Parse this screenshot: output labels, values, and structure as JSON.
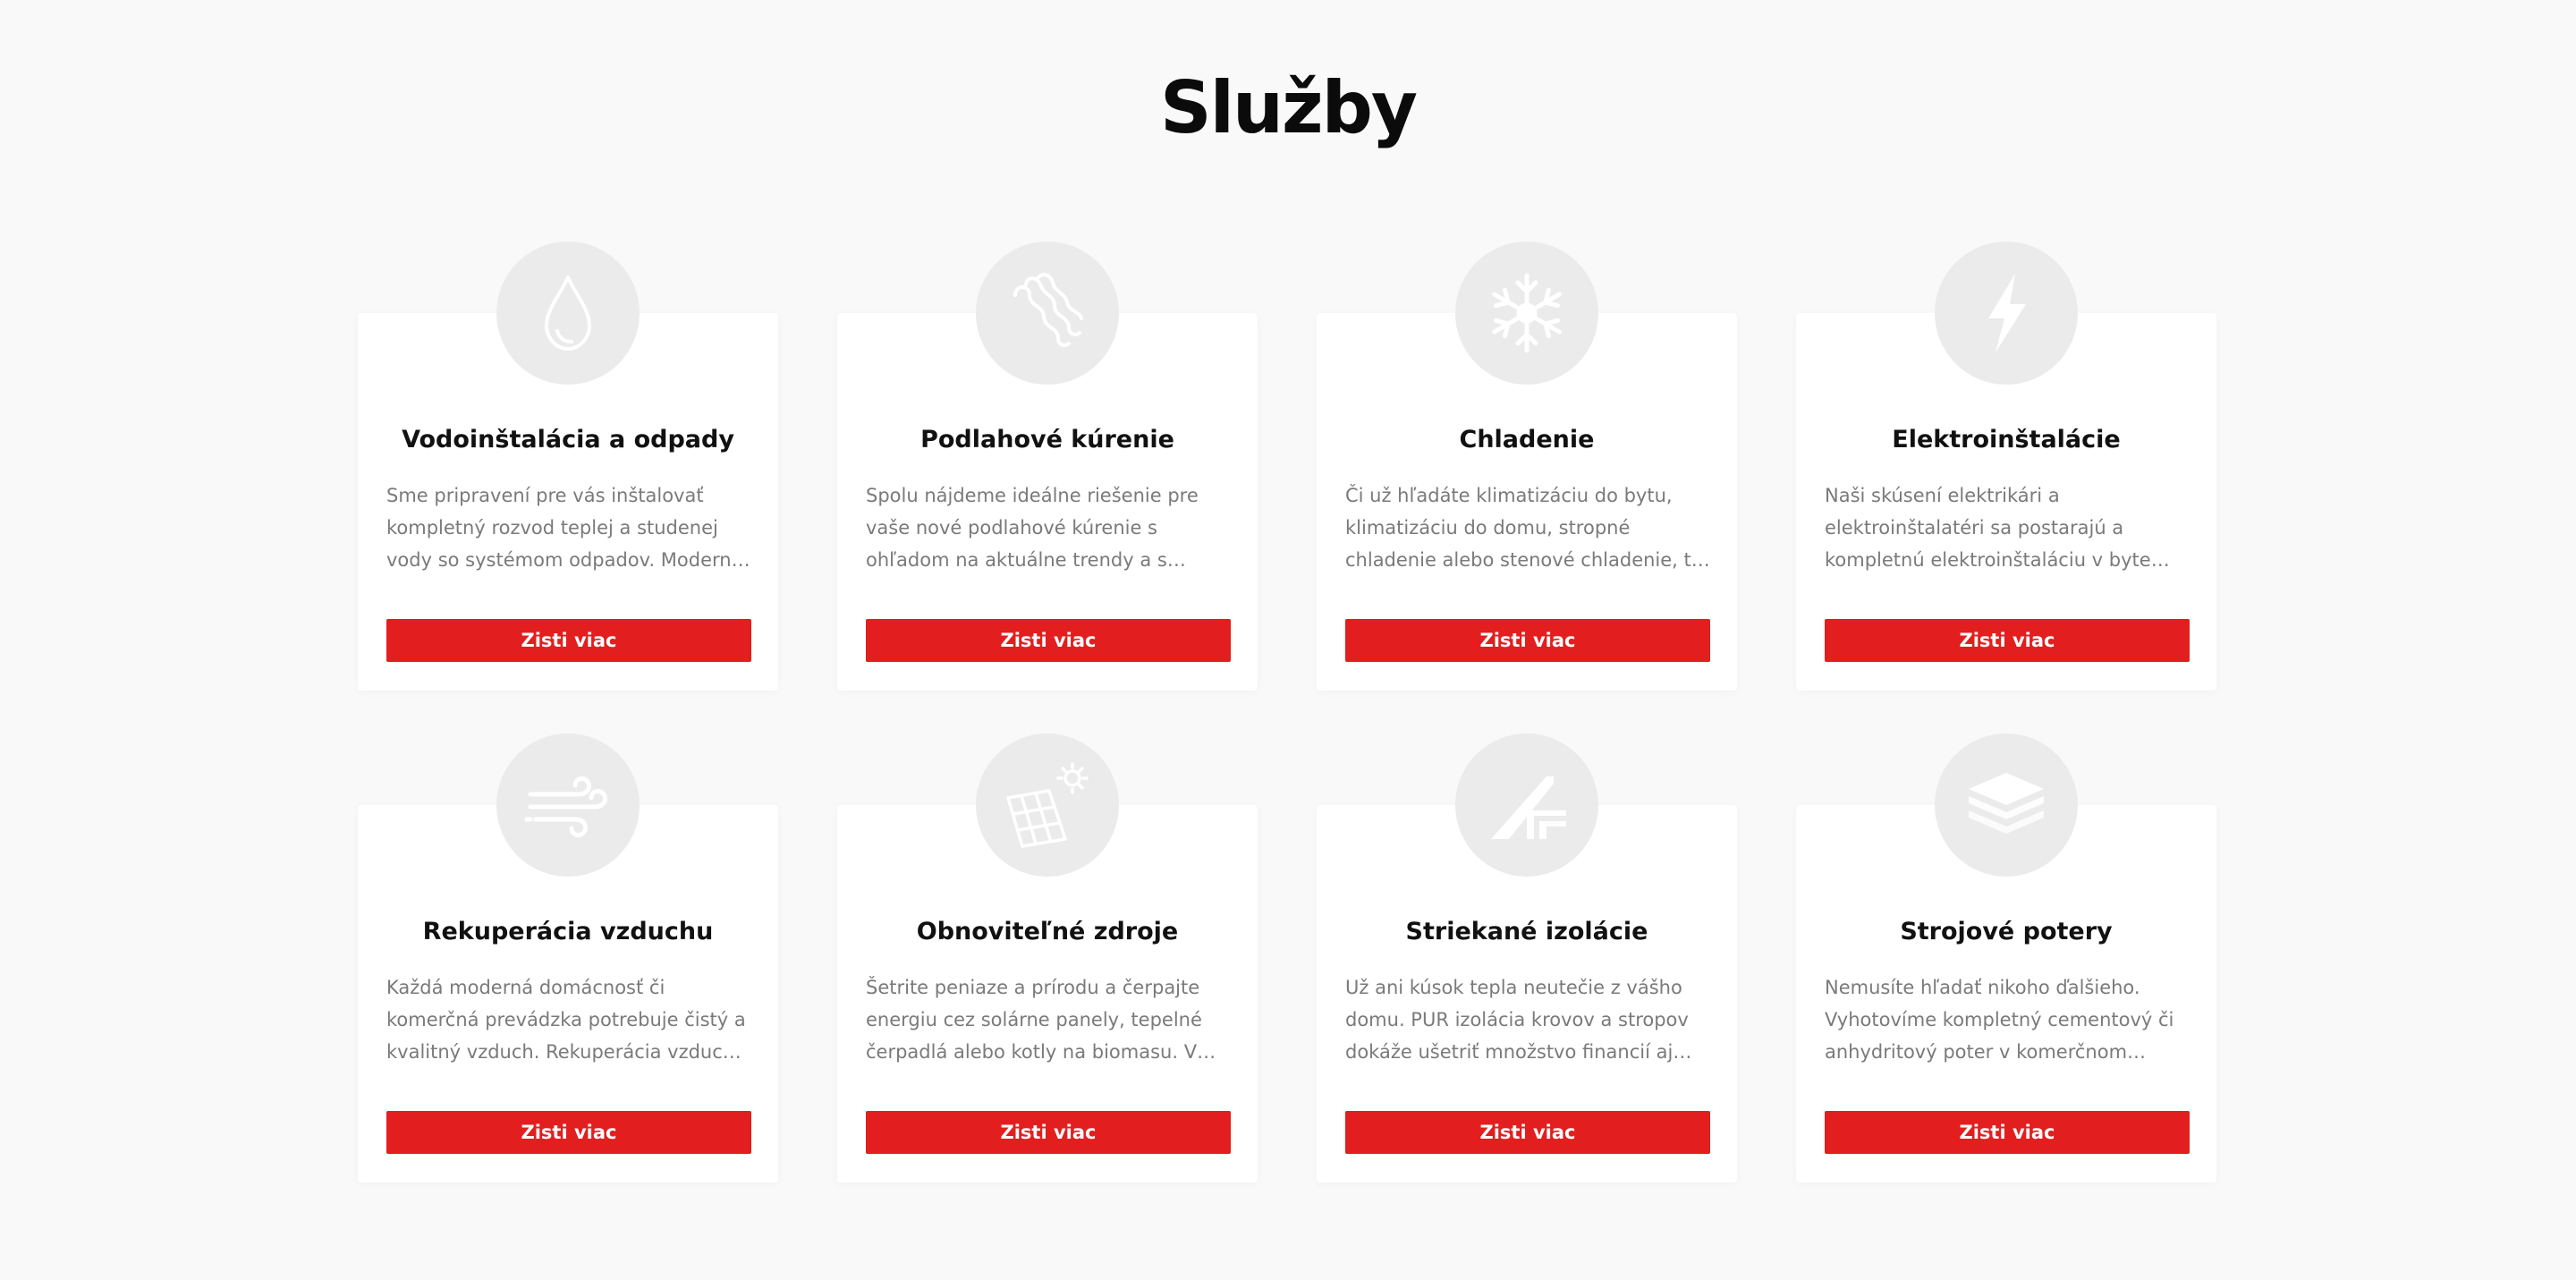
{
  "section": {
    "title": "Služby"
  },
  "services": [
    {
      "title": "Vodoinštalácia a odpady",
      "text": "Sme pripravení pre vás inštalovať kompletný rozvod teplej a studenej vody so systémom odpadov. Moderné, tiché a...",
      "button": "Zisti viac",
      "icon": "water-drop-icon"
    },
    {
      "title": "Podlahové kúrenie",
      "text": "Spolu nájdeme ideálne riešenie pre vaše nové podlahové kúrenie s ohľadom na aktuálne trendy a s pohľadom na jeho...",
      "button": "Zisti viac",
      "icon": "floor-heating-icon"
    },
    {
      "title": "Chladenie",
      "text": "Či už hľadáte klimatizáciu do bytu, klimatizáciu do domu, stropné chladenie alebo stenové chladenie, tu ste na...",
      "button": "Zisti viac",
      "icon": "snowflake-icon"
    },
    {
      "title": "Elektroinštalácie",
      "text": "Naši skúsení elektrikári a elektroinštalatéri sa postarajú a kompletnú elektroinštaláciu v byte alebo v dome a pretvoria váš...",
      "button": "Zisti viac",
      "icon": "lightning-icon"
    },
    {
      "title": "Rekuperácia vzduchu",
      "text": "Každá moderná domácnosť či komerčná prevádzka potrebuje čistý a kvalitný vzduch. Rekuperácia vzduchu od Renova...",
      "button": "Zisti viac",
      "icon": "wind-icon"
    },
    {
      "title": "Obnoviteľné zdroje",
      "text": "Šetrite peniaze a prírodu a čerpajte energiu cez solárne panely, tepelné čerpadlá alebo kotly na biomasu. V tejto...",
      "button": "Zisti viac",
      "icon": "solar-panel-icon"
    },
    {
      "title": "Striekané izolácie",
      "text": "Už ani kúsok tepla neutečie z vášho domu. PUR izolácia krovov a stropov dokáže ušetriť množstvo financií aj ako súčasť...",
      "button": "Zisti viac",
      "icon": "roof-insulation-icon"
    },
    {
      "title": "Strojové potery",
      "text": "Nemusíte hľadať nikoho ďalšieho. Vyhotovíme kompletný cementový či anhydritový poter v komerčnom objekte...",
      "button": "Zisti viac",
      "icon": "layers-icon"
    }
  ],
  "colors": {
    "accent": "#e31e1e",
    "background": "#f9f9f9",
    "card": "#ffffff",
    "icon_circle": "#ebebeb",
    "icon": "#ffffff"
  }
}
